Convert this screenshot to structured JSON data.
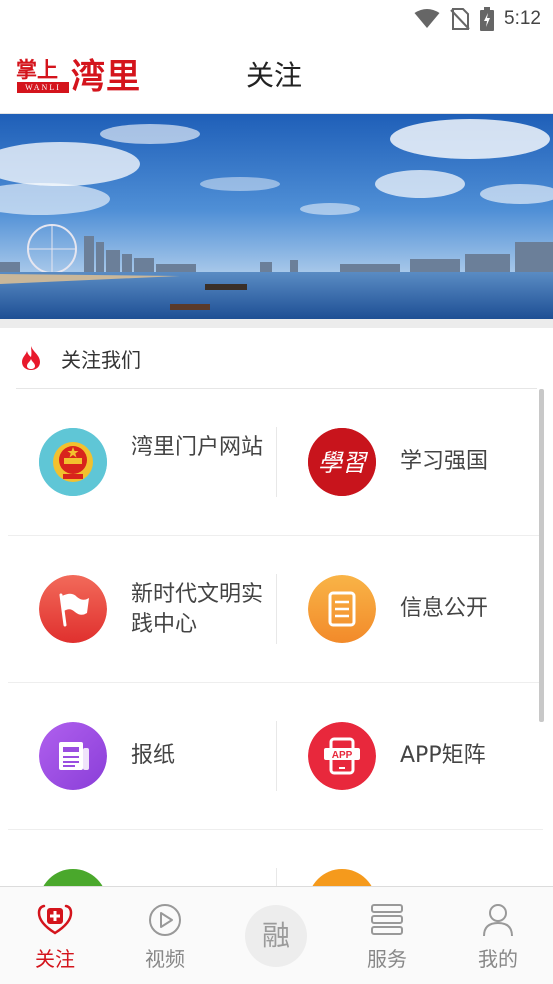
{
  "status_bar": {
    "time": "5:12"
  },
  "header": {
    "logo_small": "掌上",
    "logo_big": "湾里",
    "logo_sub": "WANLI",
    "title": "关注"
  },
  "section": {
    "title": "关注我们"
  },
  "grid": {
    "items": [
      {
        "label": "湾里门户网站",
        "icon": "national-emblem-icon",
        "color": "#5cc8d8"
      },
      {
        "label": "学习强国",
        "icon": "xuexi-logo-icon",
        "color": "#c8141c"
      },
      {
        "label": "新时代文明实践中心",
        "icon": "flag-icon",
        "color": "#e84a4a"
      },
      {
        "label": "信息公开",
        "icon": "document-list-icon",
        "color": "#f5a034"
      },
      {
        "label": "报纸",
        "icon": "newspaper-icon",
        "color": "#9a4ee0"
      },
      {
        "label": "APP矩阵",
        "icon": "app-phone-icon",
        "color": "#e8283c"
      },
      {
        "label": "",
        "icon": "green-circle-icon",
        "color": "#4aa82c"
      },
      {
        "label": "",
        "icon": "orange-circle-icon",
        "color": "#f59a1c"
      }
    ]
  },
  "bottom_nav": {
    "items": [
      {
        "label": "关注",
        "icon": "heart-plus-icon",
        "active": true
      },
      {
        "label": "视频",
        "icon": "play-circle-icon",
        "active": false
      },
      {
        "label": "融",
        "icon": "rong-center-icon",
        "active": false
      },
      {
        "label": "服务",
        "icon": "service-list-icon",
        "active": false
      },
      {
        "label": "我的",
        "icon": "user-icon",
        "active": false
      }
    ]
  },
  "colors": {
    "brand_red": "#d4141c",
    "nav_inactive": "#888888"
  }
}
